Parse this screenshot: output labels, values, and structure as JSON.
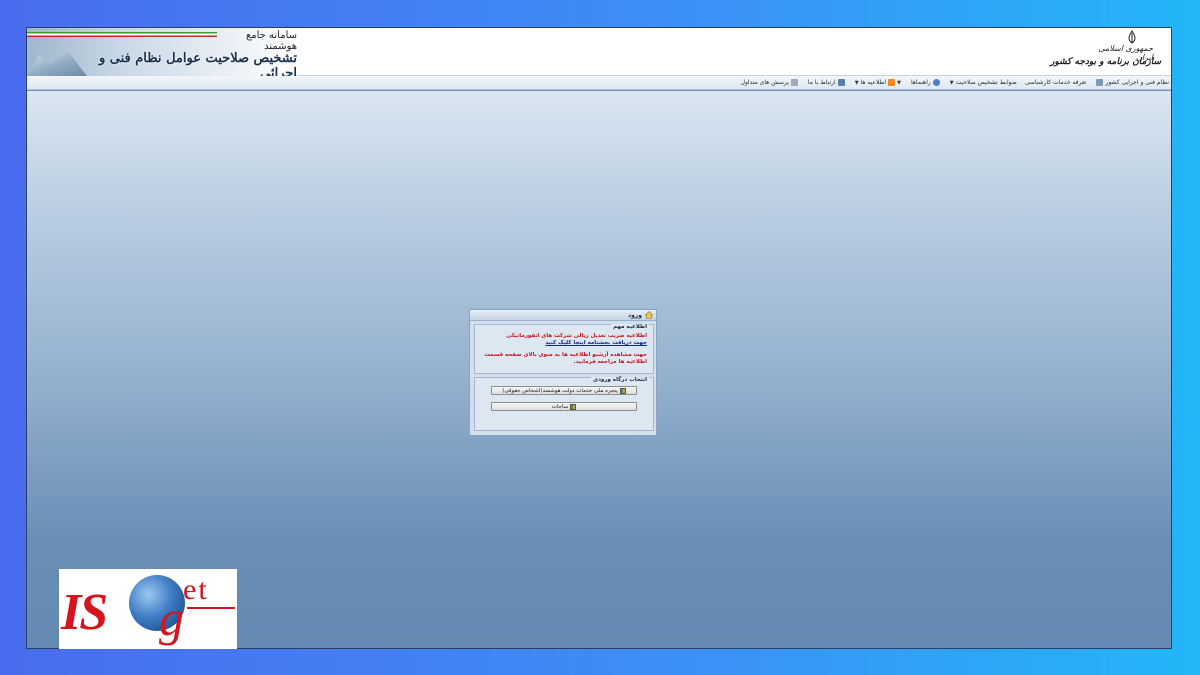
{
  "header": {
    "system_name": "سامانه جامع هوشمند",
    "system_title": "تشخیص صلاحیت عوامل نظام فنی و اجرائی",
    "logo_line1": "جمهوری اسلامی ایران",
    "logo_line2": "سازمان برنامه و بودجه کشور"
  },
  "menu": {
    "items": [
      {
        "label": "نظام فنی و اجرایی کشور",
        "icon": "folder-icon"
      },
      {
        "label": "تعرفه خدمات کارشناسی",
        "icon": "document-icon"
      },
      {
        "label": "ضوابط تشخیص صلاحیت",
        "icon": "none",
        "dropdown": true
      },
      {
        "label": "راهنماها",
        "icon": "help-icon"
      },
      {
        "label": "اطلاعیه ها",
        "icon": "rss-icon",
        "dropdown": true
      },
      {
        "label": "ارتباط با ما",
        "icon": "mail-icon"
      },
      {
        "label": "پرسش های متداول",
        "icon": "document-icon"
      }
    ]
  },
  "login": {
    "title": "ورود",
    "notice_legend": "اطلاعیه مهم",
    "notice_line1": "اطلاعیه ضریب تعدیل ریالی شرکت های انفورماتیکی",
    "notice_link": "جهت دریافت بخشنامه اینجا کلیک کنید",
    "notice_line2": "جهت مشاهده آرشیو اطلاعیه ها به منوی بالای صفحه قسمت",
    "notice_line3": "اطلاعیه ها مراجعه فرمایید.",
    "portal_legend": "انتخاب درگاه ورودی",
    "portal_btn1": "پنجره ملی خدمات دولت هوشمند(اشخاص حقوقی)",
    "portal_btn2": "ساجات"
  },
  "watermark": {
    "text_is": "IS",
    "text_g": "g",
    "text_et": "et"
  },
  "colors": {
    "notice_red": "#c8141e",
    "link_blue": "#0b2a8c",
    "brand_red": "#d4141e"
  }
}
